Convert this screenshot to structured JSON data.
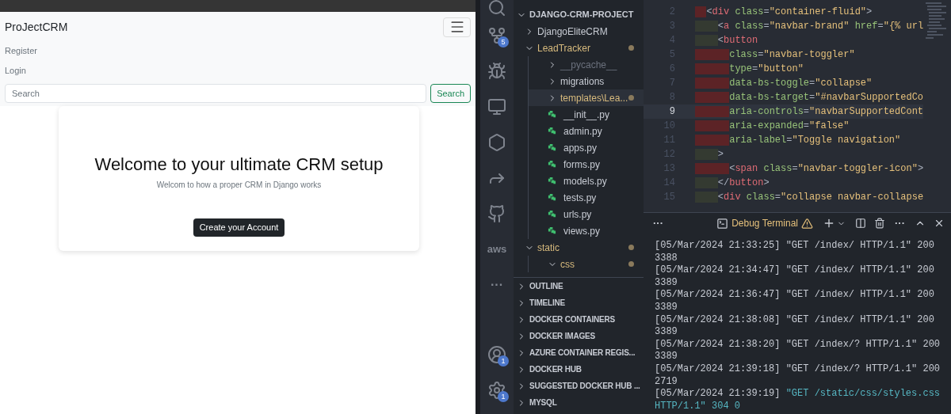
{
  "browser": {
    "navbar": {
      "brand": "ProJectCRM",
      "links": [
        "Register",
        "Login"
      ],
      "search": {
        "placeholder": "Search",
        "button": "Search"
      }
    },
    "hero": {
      "heading": "Welcome to your ultimate CRM setup",
      "subtitle": "Welcom to how a proper CRM in Django works",
      "button": "Create your Account"
    }
  },
  "activity_bar": [
    {
      "kind": "source-control",
      "badge": "5"
    },
    {
      "kind": "run-debug"
    },
    {
      "kind": "remote"
    },
    {
      "kind": "kubernetes"
    },
    {
      "kind": "live-share"
    },
    {
      "kind": "github"
    },
    {
      "kind": "aws",
      "label": "aws"
    },
    {
      "kind": "more",
      "label": "···"
    },
    {
      "kind": "spacer"
    },
    {
      "kind": "accounts",
      "badge": "1"
    },
    {
      "kind": "settings",
      "badge": "1"
    }
  ],
  "explorer": {
    "title": "DJANGO-CRM-PROJECT",
    "tree": [
      {
        "label": "DjangoEliteCRM",
        "kind": "folder",
        "expanded": false,
        "modified": false,
        "ignored": false,
        "selected": false
      },
      {
        "label": "LeadTracker",
        "kind": "folder",
        "expanded": true,
        "modified": true,
        "ignored": false,
        "selected": false,
        "children": [
          {
            "label": "__pycache__",
            "kind": "folder",
            "expanded": false,
            "modified": false,
            "ignored": true,
            "selected": false
          },
          {
            "label": "migrations",
            "kind": "folder",
            "expanded": false,
            "modified": false,
            "ignored": false,
            "selected": false
          },
          {
            "label": "templates\\Lea...",
            "kind": "folder",
            "expanded": false,
            "modified": true,
            "ignored": false,
            "selected": true
          },
          {
            "label": "__init__.py",
            "kind": "python",
            "modified": false,
            "ignored": false,
            "selected": false
          },
          {
            "label": "admin.py",
            "kind": "python",
            "modified": false,
            "ignored": false,
            "selected": false
          },
          {
            "label": "apps.py",
            "kind": "python",
            "modified": false,
            "ignored": false,
            "selected": false
          },
          {
            "label": "forms.py",
            "kind": "python",
            "modified": false,
            "ignored": false,
            "selected": false
          },
          {
            "label": "models.py",
            "kind": "python",
            "modified": false,
            "ignored": false,
            "selected": false
          },
          {
            "label": "tests.py",
            "kind": "python",
            "modified": false,
            "ignored": false,
            "selected": false
          },
          {
            "label": "urls.py",
            "kind": "python",
            "modified": false,
            "ignored": false,
            "selected": false
          },
          {
            "label": "views.py",
            "kind": "python",
            "modified": false,
            "ignored": false,
            "selected": false
          }
        ]
      },
      {
        "label": "static",
        "kind": "folder",
        "expanded": true,
        "modified": true,
        "ignored": false,
        "selected": false,
        "children": [
          {
            "label": "css",
            "kind": "folder",
            "expanded": true,
            "modified": true,
            "ignored": false,
            "selected": false
          }
        ]
      }
    ],
    "sections": [
      "OUTLINE",
      "TIMELINE",
      "DOCKER CONTAINERS",
      "DOCKER IMAGES",
      "AZURE CONTAINER REGIS...",
      "DOCKER HUB",
      "SUGGESTED DOCKER HUB ...",
      "MYSQL"
    ]
  },
  "editor": {
    "lines": [
      {
        "number": "2",
        "text": "  <div class=\"container-fluid\">",
        "color": "#5c2326",
        "current": false
      },
      {
        "number": "3",
        "text": "    <a class=\"navbar-brand\" href=\"{% url",
        "color": "#343a31",
        "current": false
      },
      {
        "number": "4",
        "text": "    <button",
        "color": "#343a31",
        "current": false
      },
      {
        "number": "5",
        "text": "      class=\"navbar-toggler\"",
        "color": "#5c2326",
        "current": false
      },
      {
        "number": "6",
        "text": "      type=\"button\"",
        "color": "#5c2326",
        "current": false
      },
      {
        "number": "7",
        "text": "      data-bs-toggle=\"collapse\"",
        "color": "#5c2326",
        "current": false
      },
      {
        "number": "8",
        "text": "      data-bs-target=\"#navbarSupportedCo",
        "color": "#5c2326",
        "current": false
      },
      {
        "number": "9",
        "text": "      aria-controls=\"navbarSupportedCont",
        "color": "#5c2326",
        "current": true
      },
      {
        "number": "10",
        "text": "      aria-expanded=\"false\"",
        "color": "#5c2326",
        "current": false
      },
      {
        "number": "11",
        "text": "      aria-label=\"Toggle navigation\"",
        "color": "#5c2326",
        "current": false
      },
      {
        "number": "12",
        "text": "    >",
        "color": "#343a31",
        "current": false
      },
      {
        "number": "13",
        "text": "      <span class=\"navbar-toggler-icon\">",
        "color": "#5c2326",
        "current": false
      },
      {
        "number": "14",
        "text": "    </button>",
        "color": "#343a31",
        "current": false
      },
      {
        "number": "15",
        "text": "    <div class=\"collapse navbar-collapse",
        "color": "#343a31",
        "current": false
      }
    ]
  },
  "terminal": {
    "overflow": "···",
    "name": "Debug Terminal",
    "more": "···",
    "entries": [
      {
        "time": "[05/Mar/2024 21:33:25]",
        "message": " \"GET /index/ HTTP/1.1\" 200 3388",
        "kind": "plain"
      },
      {
        "time": "[05/Mar/2024 21:34:47]",
        "message": " \"GET /index/ HTTP/1.1\" 200 3389",
        "kind": "plain"
      },
      {
        "time": "[05/Mar/2024 21:36:47]",
        "message": " \"GET /index/ HTTP/1.1\" 200 3389",
        "kind": "plain"
      },
      {
        "time": "[05/Mar/2024 21:38:08]",
        "message": " \"GET /index/ HTTP/1.1\" 200 3389",
        "kind": "plain"
      },
      {
        "time": "[05/Mar/2024 21:38:20]",
        "message": " \"GET /index/? HTTP/1.1\" 200 3389",
        "kind": "plain"
      },
      {
        "time": "[05/Mar/2024 21:39:18]",
        "message": " \"GET /index/? HTTP/1.1\" 200 2719",
        "kind": "plain"
      },
      {
        "time": "[05/Mar/2024 21:39:19]",
        "message": " \"GET /static/css/styles.css HTTP/1.1\" 304 0",
        "kind": "info"
      }
    ]
  }
}
